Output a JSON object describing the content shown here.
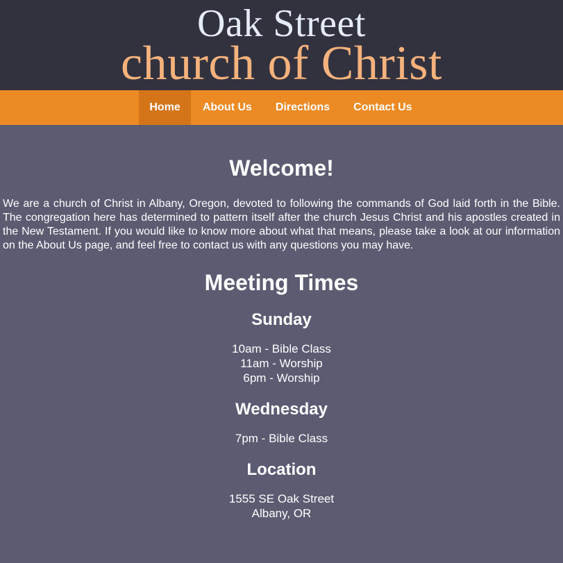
{
  "header": {
    "logo_line1": "Oak Street",
    "logo_line2": "church of Christ"
  },
  "nav": {
    "items": [
      {
        "label": "Home",
        "active": true
      },
      {
        "label": "About Us",
        "active": false
      },
      {
        "label": "Directions",
        "active": false
      },
      {
        "label": "Contact Us",
        "active": false
      }
    ]
  },
  "main": {
    "welcome_title": "Welcome!",
    "intro": "We are a church of Christ in Albany, Oregon, devoted to following the commands of God laid forth in the Bible. The congregation here has determined to pattern itself after the church Jesus Christ and his apostles created in the New Testament. If you would like to know more about what that means, please take a look at our information on the About Us page, and feel free to contact us with any questions you may have.",
    "meeting_title": "Meeting Times",
    "sunday": {
      "title": "Sunday",
      "lines": [
        "10am - Bible Class",
        "11am - Worship",
        "6pm - Worship"
      ]
    },
    "wednesday": {
      "title": "Wednesday",
      "lines": [
        "7pm - Bible Class"
      ]
    },
    "location": {
      "title": "Location",
      "lines": [
        "1555 SE Oak Street",
        "Albany, OR"
      ]
    }
  },
  "colors": {
    "header_bg": "#32323f",
    "nav_bg": "#ec8a23",
    "nav_active_bg": "#d47519",
    "page_bg": "#5b5b72",
    "logo_line1": "#e6ecf7",
    "logo_line2": "#f5b27c"
  }
}
